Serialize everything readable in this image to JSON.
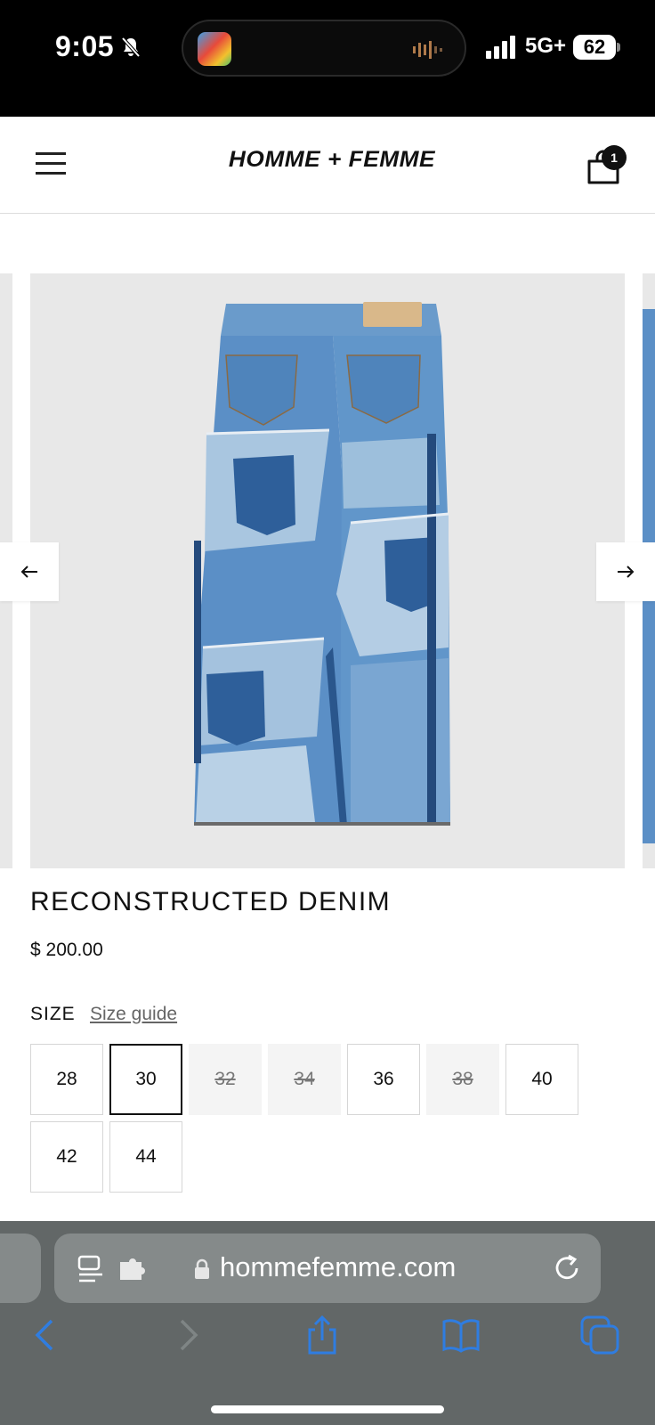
{
  "status_bar": {
    "time": "9:05",
    "network": "5G+",
    "battery": "62"
  },
  "header": {
    "brand": "HOMME + FEMME",
    "cart_count": "1"
  },
  "product": {
    "title": "RECONSTRUCTED DENIM",
    "price": "$ 200.00",
    "size_label": "SIZE",
    "size_guide_label": "Size guide",
    "sizes": [
      {
        "label": "28",
        "state": "available"
      },
      {
        "label": "30",
        "state": "selected"
      },
      {
        "label": "32",
        "state": "unavailable"
      },
      {
        "label": "34",
        "state": "unavailable"
      },
      {
        "label": "36",
        "state": "available"
      },
      {
        "label": "38",
        "state": "unavailable"
      },
      {
        "label": "40",
        "state": "available"
      },
      {
        "label": "42",
        "state": "available"
      },
      {
        "label": "44",
        "state": "available"
      }
    ]
  },
  "browser": {
    "url": "hommefemme.com"
  },
  "colors": {
    "accent_blue": "#2f7de1",
    "denim_mid": "#5b8fc6",
    "denim_light": "#a9c6e0",
    "denim_dark": "#2e5f9a"
  }
}
